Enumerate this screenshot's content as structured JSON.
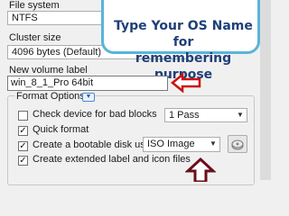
{
  "file_system": {
    "label": "File system",
    "value": "NTFS"
  },
  "cluster_size": {
    "label": "Cluster size",
    "value": "4096 bytes (Default)"
  },
  "volume_label": {
    "label": "New volume label",
    "value": "win_8_1_Pro 64bit"
  },
  "format_options": {
    "title": "Format Options",
    "check_bad_blocks": {
      "label": "Check device for bad blocks",
      "checked": false,
      "passes": "1 Pass"
    },
    "quick_format": {
      "label": "Quick format",
      "checked": true
    },
    "bootable_disk": {
      "label": "Create a bootable disk using",
      "checked": true,
      "type": "ISO Image"
    },
    "extended_label": {
      "label": "Create extended label and icon files",
      "checked": true
    }
  },
  "callout": {
    "line1": "Type Your OS Name for",
    "line2": "remembering purpose"
  },
  "colors": {
    "callout_border": "#5ab4d8",
    "callout_text": "#1f3f77",
    "annotation_arrow": "#cc1111",
    "dark_arrow": "#6a0f1a"
  }
}
